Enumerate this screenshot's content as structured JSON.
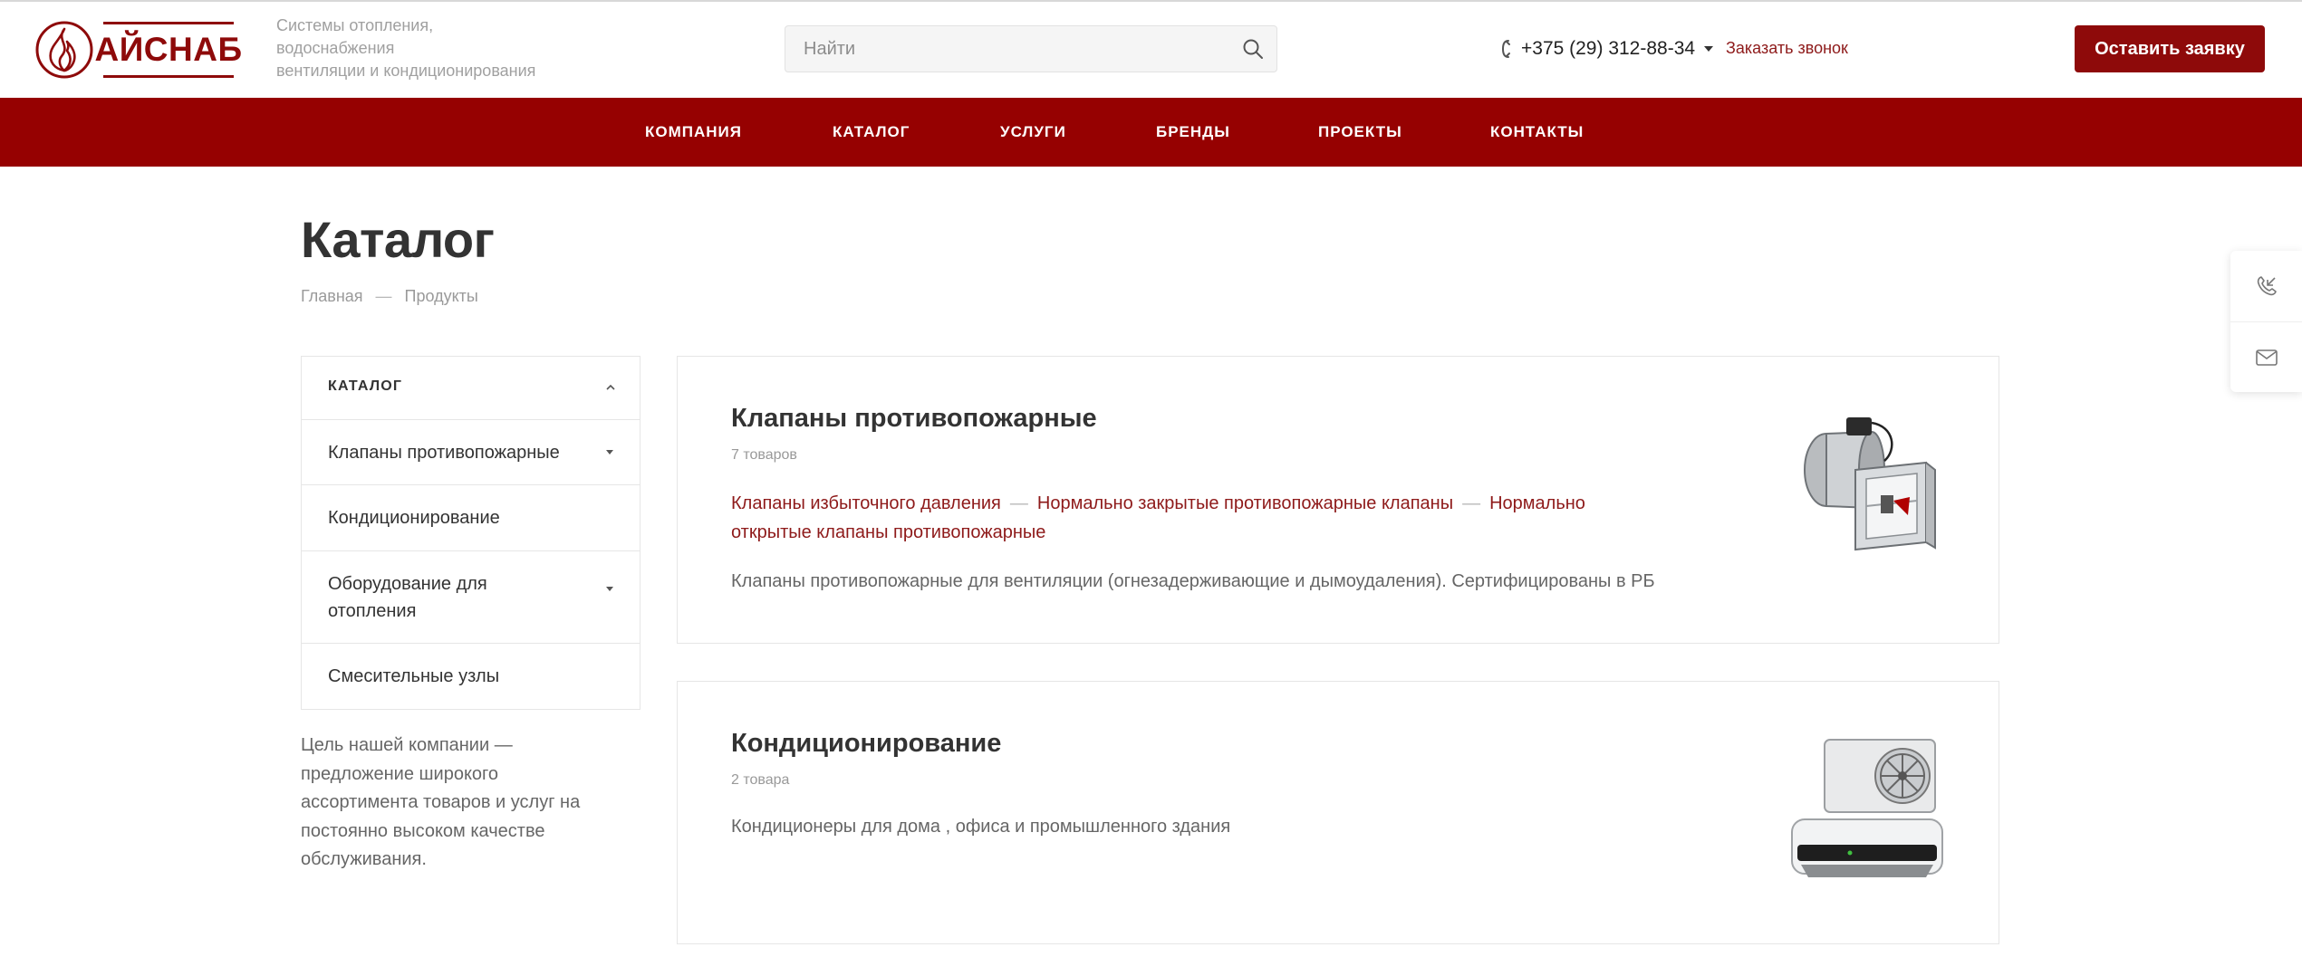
{
  "header": {
    "logo_text": "АЙСНАБ",
    "tagline": [
      "Системы отопления,",
      "водоснабжения",
      "вентиляции и кондиционирования"
    ],
    "search_placeholder": "Найти",
    "phone": "+375 (29) 312-88-34",
    "callback_label": "Заказать звонок",
    "cta_label": "Оставить заявку"
  },
  "nav": {
    "items": [
      {
        "label": "КОМПАНИЯ"
      },
      {
        "label": "КАТАЛОГ"
      },
      {
        "label": "УСЛУГИ"
      },
      {
        "label": "БРЕНДЫ"
      },
      {
        "label": "ПРОЕКТЫ"
      },
      {
        "label": "КОНТАКТЫ"
      }
    ]
  },
  "page": {
    "title": "Каталог",
    "breadcrumbs": [
      "Главная",
      "Продукты"
    ],
    "breadcrumb_sep": "—"
  },
  "sidebar": {
    "header": "КАТАЛОГ",
    "items": [
      {
        "label": "Клапаны противопожарные"
      },
      {
        "label": "Кондиционирование"
      },
      {
        "label": "Оборудование для отопления"
      },
      {
        "label": "Смесительные узлы"
      }
    ],
    "about": "Цель нашей компании — предложение широкого ассортимента товаров и услуг на постоянно высоком качестве обслуживания."
  },
  "catalog": [
    {
      "title": "Клапаны противопожарные",
      "count": "7 товаров",
      "links": [
        "Клапаны избыточного давления",
        "Нормально закрытые противопожарные клапаны",
        "Нормально открытые клапаны противопожарные"
      ],
      "description": "Клапаны противопожарные для вентиляции (огнезадерживающие и дымоудаления). Сертифицированы в РБ"
    },
    {
      "title": "Кондиционирование",
      "count": "2 товара",
      "links": [],
      "description": "Кондиционеры для дома , офиса и промышленного здания"
    }
  ],
  "colors": {
    "brand": "#8e0a0a",
    "nav_bg": "#960101",
    "link": "#8e1a1a"
  }
}
